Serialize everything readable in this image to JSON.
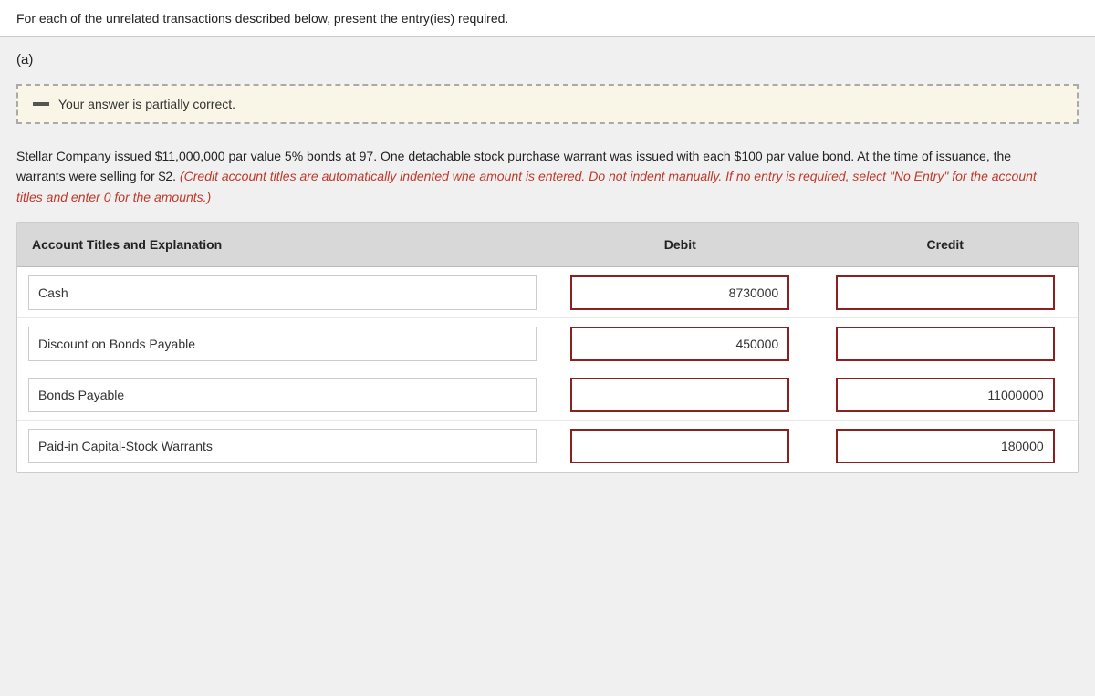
{
  "instruction": "For each of the unrelated transactions described below, present the entry(ies) required.",
  "section": "(a)",
  "partial_correct_icon": "minus",
  "partial_correct_text": "Your answer is partially correct.",
  "problem_text_normal": "Stellar Company issued $11,000,000 par value 5% bonds at 97. One detachable stock purchase warrant was issued with each $100 par value bond. At the time of issuance, the warrants were selling for $2. ",
  "problem_text_italic": "(Credit account titles are automatically indented whe amount is entered. Do not indent manually. If no entry is required, select \"No Entry\" for the account titles and enter 0 for the amounts.)",
  "table": {
    "header": {
      "col1": "Account Titles and Explanation",
      "col2": "Debit",
      "col3": "Credit"
    },
    "rows": [
      {
        "account": "Cash",
        "debit": "8730000",
        "credit": ""
      },
      {
        "account": "Discount on Bonds Payable",
        "debit": "450000",
        "credit": ""
      },
      {
        "account": "Bonds Payable",
        "debit": "",
        "credit": "11000000"
      },
      {
        "account": "Paid-in Capital-Stock Warrants",
        "debit": "",
        "credit": "180000"
      }
    ]
  }
}
